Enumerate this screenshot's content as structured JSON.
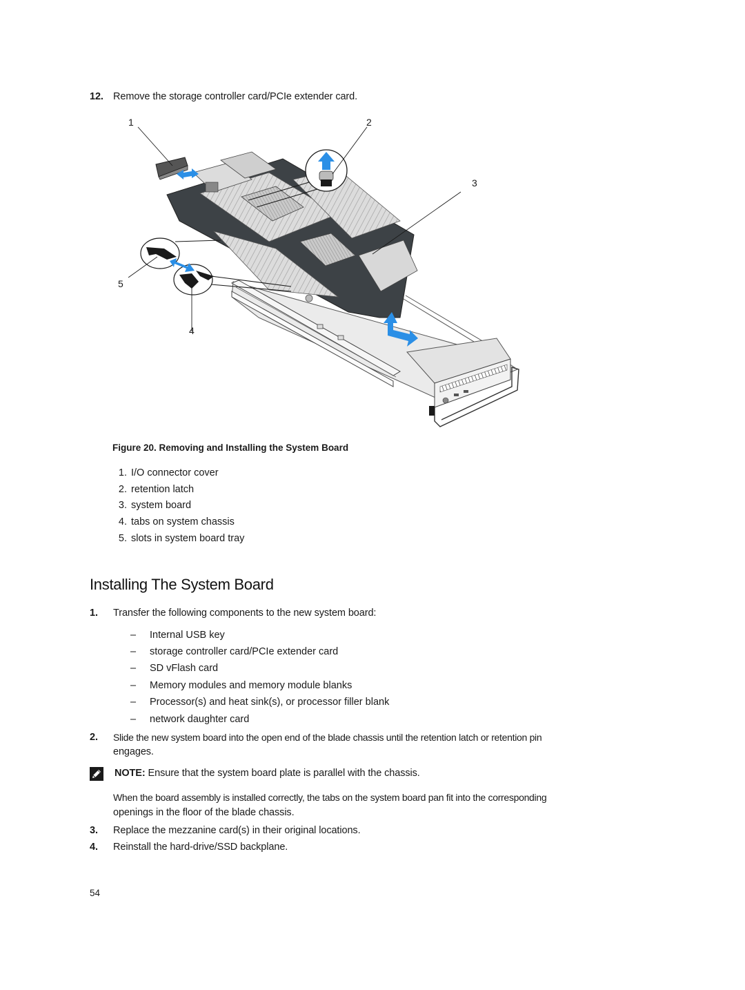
{
  "step12": {
    "number": "12.",
    "text": "Remove the storage controller card/PCIe extender card."
  },
  "figure": {
    "callouts": [
      "1",
      "2",
      "3",
      "4",
      "5"
    ],
    "caption": "Figure 20. Removing and Installing the System Board",
    "arrow_color": "#2b8fe6",
    "legend": [
      {
        "num": "1.",
        "label": "I/O connector cover"
      },
      {
        "num": "2.",
        "label": "retention latch"
      },
      {
        "num": "3.",
        "label": "system board"
      },
      {
        "num": "4.",
        "label": "tabs on system chassis"
      },
      {
        "num": "5.",
        "label": "slots in system board tray"
      }
    ]
  },
  "section": {
    "title": "Installing The System Board"
  },
  "steps": [
    {
      "number": "1.",
      "text": "Transfer the following components to the new system board:",
      "subitems": [
        "Internal USB key",
        "storage controller card/PCIe extender card",
        "SD vFlash card",
        "Memory modules and memory module blanks",
        "Processor(s) and heat sink(s), or processor filler blank",
        "network daughter card"
      ]
    },
    {
      "number": "2.",
      "text_line1": "Slide the new system board into the open end of the blade chassis until the retention latch or retention pin",
      "text_line2": "engages."
    },
    {
      "number": "3.",
      "text": "Replace the mezzanine card(s) in their original locations."
    },
    {
      "number": "4.",
      "text": "Reinstall the hard-drive/SSD backplane."
    }
  ],
  "note": {
    "icon": "pencil-note-icon",
    "label": "NOTE:",
    "text": " Ensure that the system board plate is parallel with the chassis."
  },
  "after_note": {
    "line1": "When the board assembly is installed correctly, the tabs on the system board pan fit into the corresponding",
    "line2": "openings in the floor of the blade chassis."
  },
  "dash": "–",
  "page_number": "54"
}
